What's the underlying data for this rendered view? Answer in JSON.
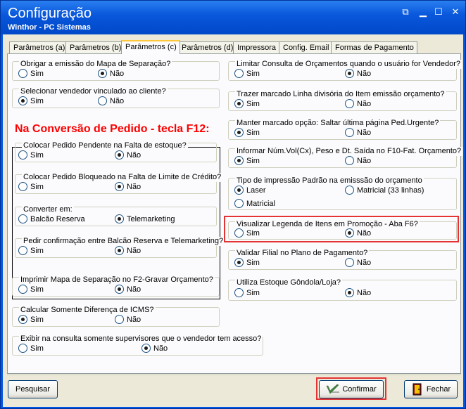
{
  "window": {
    "title": "Configuração",
    "subtitle": "Winthor - PC Sistemas",
    "ctrl_resize": "⧉",
    "ctrl_minimize": "▁",
    "ctrl_maximize": "☐",
    "ctrl_close": "✕"
  },
  "tabs": [
    "Parâmetros (a)",
    "Parâmetros (b)",
    "Parâmetros (c)",
    "Parâmetros (d)",
    "Impressora",
    "Config. Email",
    "Formas de Pagamento"
  ],
  "options": {
    "sim": "Sim",
    "nao": "Não"
  },
  "left": {
    "q1": "Obrigar a emissão do Mapa de Separação?",
    "q2": "Selecionar vendedor vinculado ao cliente?",
    "section_title": "Na Conversão de Pedido - tecla F12:",
    "q3": "Colocar Pedido Pendente na Falta de estoque?",
    "q4": "Colocar Pedido Bloqueado na Falta de Limite de Crédito?",
    "q5": "Converter em:",
    "q5_opt1": "Balcão Reserva",
    "q5_opt2": "Telemarketing",
    "q6": "Pedir confirmação entre Balcão Reserva e Telemarketing?",
    "q7": "Imprimir Mapa de Separação no F2-Gravar Orçamento?",
    "q8": "Calcular Somente Diferença de ICMS?",
    "q9": "Exibir na consulta somente supervisores que o vendedor tem acesso?"
  },
  "right": {
    "q1": "Limitar Consulta de Orçamentos quando o usuário for Vendedor?",
    "q2": "Trazer marcado Linha divisória do Item emissão orçamento?",
    "q3": "Manter marcado opção: Saltar última página Ped.Urgente?",
    "q4": "Informar Núm.Vol(Cx), Peso e Dt. Saída no F10-Fat. Orçamento?",
    "q5": "Tipo de impressão Padrão na emisssão do orçamento",
    "q5_opt1": "Laser",
    "q5_opt2": "Matricial (33 linhas)",
    "q5_opt3": "Matricial",
    "q6": "Visualizar Legenda de Itens em Promoção - Aba F6?",
    "q7": "Validar Filial no Plano de Pagamento?",
    "q8": "Utiliza Estoque Gôndola/Loja?"
  },
  "buttons": {
    "search": "Pesquisar",
    "confirm": "Confirmar",
    "close": "Fechar"
  },
  "colors": {
    "title_bar": "#0a58dc",
    "highlight": "#e53333",
    "heading_red": "#ff0000"
  }
}
